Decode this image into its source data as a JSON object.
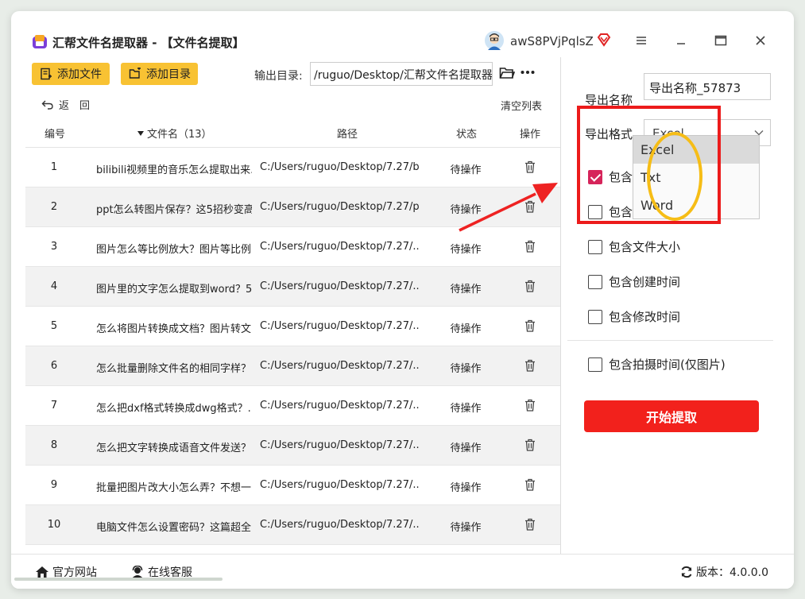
{
  "title": "汇帮文件名提取器 - 【文件名提取】",
  "user": {
    "name": "awS8PVjPqlsZ"
  },
  "toolbar": {
    "add_file": "添加文件",
    "add_folder": "添加目录",
    "output_label": "输出目录:",
    "output_path": "/ruguo/Desktop/汇帮文件名提取器"
  },
  "nav": {
    "back": "返　回",
    "clear": "清空列表"
  },
  "table": {
    "headers": {
      "no": "编号",
      "name": "文件名（13）",
      "path": "路径",
      "status": "状态",
      "action": "操作"
    },
    "rows": [
      {
        "no": "1",
        "name": "bilibili视频里的音乐怎么提取出来...",
        "path": "C:/Users/ruguo/Desktop/7.27/b...",
        "status": "待操作"
      },
      {
        "no": "2",
        "name": "ppt怎么转图片保存？这5招秒变高...",
        "path": "C:/Users/ruguo/Desktop/7.27/p...",
        "status": "待操作"
      },
      {
        "no": "3",
        "name": "图片怎么等比例放大？图片等比例...",
        "path": "C:/Users/ruguo/Desktop/7.27/...",
        "status": "待操作"
      },
      {
        "no": "4",
        "name": "图片里的文字怎么提取到word？5...",
        "path": "C:/Users/ruguo/Desktop/7.27/...",
        "status": "待操作"
      },
      {
        "no": "5",
        "name": "怎么将图片转换成文档？图片转文...",
        "path": "C:/Users/ruguo/Desktop/7.27/...",
        "status": "待操作"
      },
      {
        "no": "6",
        "name": "怎么批量删除文件名的相同字样？...",
        "path": "C:/Users/ruguo/Desktop/7.27/...",
        "status": "待操作"
      },
      {
        "no": "7",
        "name": "怎么把dxf格式转换成dwg格式？...",
        "path": "C:/Users/ruguo/Desktop/7.27/...",
        "status": "待操作"
      },
      {
        "no": "8",
        "name": "怎么把文字转换成语音文件发送？...",
        "path": "C:/Users/ruguo/Desktop/7.27/...",
        "status": "待操作"
      },
      {
        "no": "9",
        "name": "批量把图片改大小怎么弄？不想一...",
        "path": "C:/Users/ruguo/Desktop/7.27/...",
        "status": "待操作"
      },
      {
        "no": "10",
        "name": "电脑文件怎么设置密码？这篇超全...",
        "path": "C:/Users/ruguo/Desktop/7.27/...",
        "status": "待操作"
      }
    ]
  },
  "panel": {
    "export_name_label": "导出名称",
    "export_name_value": "导出名称_57873",
    "export_format_label": "导出格式",
    "export_format_value": "Excel",
    "format_options": [
      "Excel",
      "Txt",
      "Word"
    ],
    "opt_suffix": "包含后",
    "opt_folder": "包含文",
    "opt_size": "包含文件大小",
    "opt_ctime": "包含创建时间",
    "opt_mtime": "包含修改时间",
    "opt_shot": "包含拍摄时间(仅图片)",
    "start": "开始提取"
  },
  "footer": {
    "site": "官方网站",
    "service": "在线客服",
    "version": "版本：4.0.0.0"
  },
  "colors": {
    "accent_yellow": "#f8c233",
    "start_red": "#f2211c",
    "check_pink": "#d6245a",
    "annot_red": "#ec1b1b",
    "annot_yellow": "#f6bd16"
  }
}
